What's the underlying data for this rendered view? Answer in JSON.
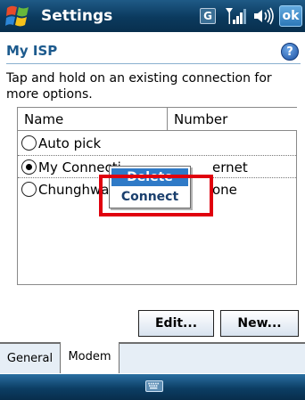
{
  "titlebar": {
    "title": "Settings",
    "status_network": "G",
    "ok_label": "ok",
    "icons": [
      "windows-start-icon",
      "network-g-icon",
      "signal-strength-icon",
      "volume-icon"
    ]
  },
  "header": {
    "title": "My ISP",
    "help_label": "?"
  },
  "instruction": "Tap and hold on an existing connection for more options.",
  "list": {
    "columns": [
      "Name",
      "Number"
    ],
    "rows": [
      {
        "name": "Auto pick",
        "number": "",
        "checked": false
      },
      {
        "name": "My Connecti",
        "number": "ernet",
        "checked": true
      },
      {
        "name": "Chunghwa",
        "number": "one",
        "checked": false
      }
    ]
  },
  "context_menu": {
    "items": [
      "Delete",
      "Connect"
    ]
  },
  "buttons": {
    "edit": "Edit...",
    "new": "New..."
  },
  "tabs": [
    "General",
    "Modem"
  ],
  "colors": {
    "title_bar": "#0b3a5e",
    "header_text": "#1c5a8d",
    "highlight_box": "#e0000e",
    "menu_selected": "#2f7ac7"
  }
}
